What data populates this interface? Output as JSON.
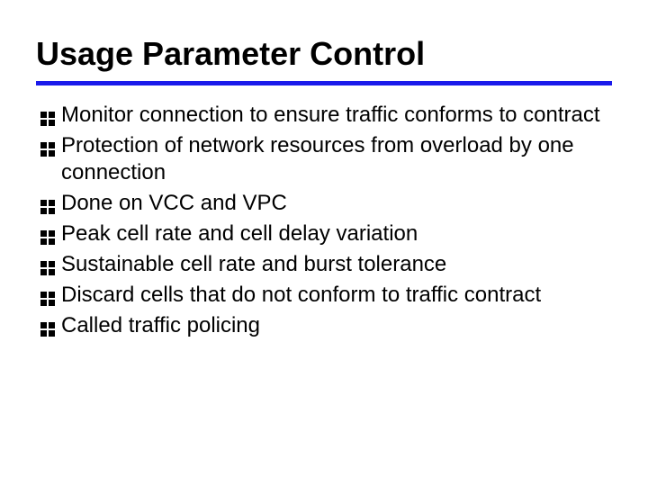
{
  "title": "Usage Parameter Control",
  "bullets": [
    "Monitor connection to ensure traffic conforms to contract",
    "Protection of network resources from overload by one connection",
    "Done on VCC and VPC",
    "Peak cell rate and cell delay variation",
    "Sustainable cell rate and burst tolerance",
    "Discard cells that do not conform to traffic contract",
    "Called traffic policing"
  ]
}
